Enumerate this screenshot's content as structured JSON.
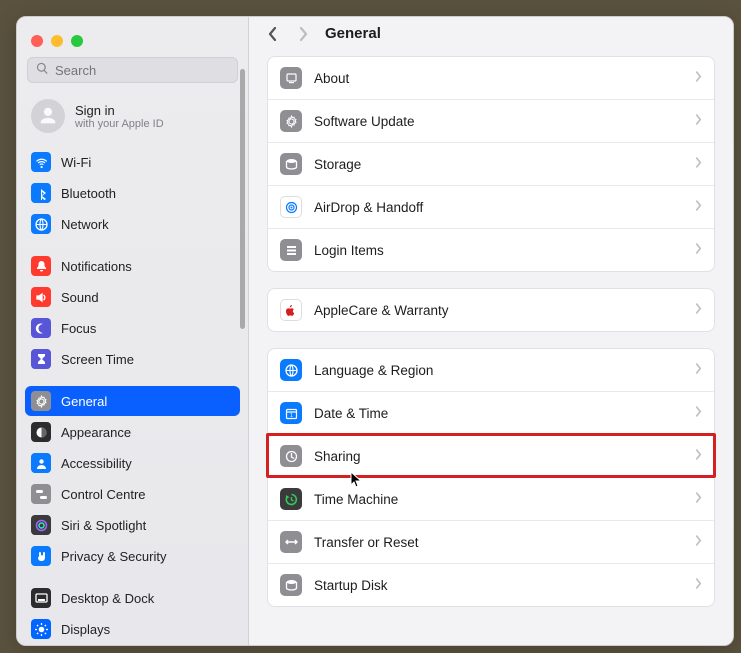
{
  "search": {
    "placeholder": "Search"
  },
  "signin": {
    "title": "Sign in",
    "subtitle": "with your Apple ID"
  },
  "sidebar": {
    "groups": [
      [
        {
          "label": "Wi-Fi",
          "bg": "bg-blue",
          "icon": "wifi"
        },
        {
          "label": "Bluetooth",
          "bg": "bg-blue",
          "icon": "bluetooth"
        },
        {
          "label": "Network",
          "bg": "bg-blue",
          "icon": "globe"
        }
      ],
      [
        {
          "label": "Notifications",
          "bg": "bg-red",
          "icon": "bell"
        },
        {
          "label": "Sound",
          "bg": "bg-red",
          "icon": "speaker"
        },
        {
          "label": "Focus",
          "bg": "bg-purple",
          "icon": "moon"
        },
        {
          "label": "Screen Time",
          "bg": "bg-purple",
          "icon": "hourglass"
        }
      ],
      [
        {
          "label": "General",
          "bg": "bg-gray",
          "icon": "gear",
          "selected": true
        },
        {
          "label": "Appearance",
          "bg": "bg-black",
          "icon": "contrast"
        },
        {
          "label": "Accessibility",
          "bg": "bg-blue",
          "icon": "person"
        },
        {
          "label": "Control Centre",
          "bg": "bg-gray",
          "icon": "switches"
        },
        {
          "label": "Siri & Spotlight",
          "bg": "bg-dark",
          "icon": "siri"
        },
        {
          "label": "Privacy & Security",
          "bg": "bg-blue",
          "icon": "hand"
        }
      ],
      [
        {
          "label": "Desktop & Dock",
          "bg": "bg-black",
          "icon": "dock"
        },
        {
          "label": "Displays",
          "bg": "bg-blue2",
          "icon": "sun"
        }
      ]
    ]
  },
  "header": {
    "title": "General"
  },
  "sections": [
    [
      {
        "label": "About",
        "bg": "bg-gray",
        "icon": "mac"
      },
      {
        "label": "Software Update",
        "bg": "bg-gray",
        "icon": "gear"
      },
      {
        "label": "Storage",
        "bg": "bg-gray",
        "icon": "disk"
      },
      {
        "label": "AirDrop & Handoff",
        "bg": "bg-white",
        "icon": "airdrop"
      },
      {
        "label": "Login Items",
        "bg": "bg-gray",
        "icon": "list"
      }
    ],
    [
      {
        "label": "AppleCare & Warranty",
        "bg": "bg-white",
        "icon": "apple"
      }
    ],
    [
      {
        "label": "Language & Region",
        "bg": "bg-blue",
        "icon": "globe"
      },
      {
        "label": "Date & Time",
        "bg": "bg-blue",
        "icon": "calendar"
      },
      {
        "label": "Sharing",
        "bg": "bg-gray",
        "icon": "share",
        "highlighted": true
      },
      {
        "label": "Time Machine",
        "bg": "bg-dark",
        "icon": "clockback"
      },
      {
        "label": "Transfer or Reset",
        "bg": "bg-gray",
        "icon": "arrows"
      },
      {
        "label": "Startup Disk",
        "bg": "bg-gray",
        "icon": "disk"
      }
    ]
  ]
}
